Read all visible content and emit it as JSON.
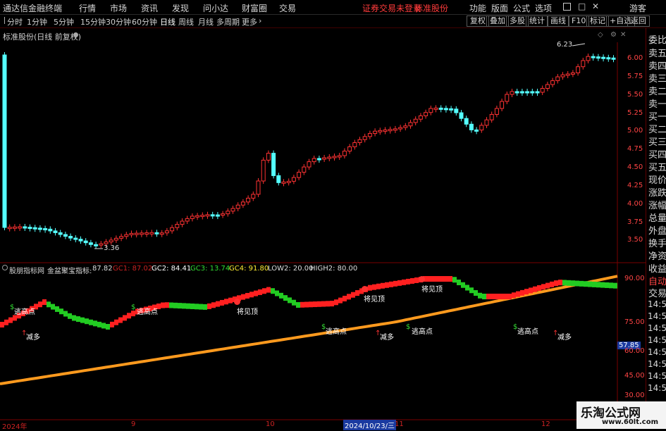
{
  "menu": {
    "app_title": "通达信金融终端",
    "items": [
      "行情",
      "市场",
      "资讯",
      "发现",
      "问小达",
      "财富圈",
      "交易"
    ],
    "notice": "证券交易未登录",
    "stock_name": "标准股份",
    "right_items": [
      "功能",
      "版面",
      "公式",
      "选项"
    ],
    "guest": "游客"
  },
  "period": {
    "items": [
      "分时",
      "1分钟",
      "5分钟",
      "15分钟",
      "30分钟",
      "60分钟",
      "日线",
      "周线",
      "月线",
      "多周期",
      "更多"
    ],
    "active": "日线",
    "buttons": [
      "复权",
      "叠加",
      "多股",
      "统计",
      "画线",
      "F10",
      "标记",
      "+自选",
      "返回"
    ]
  },
  "chart_header": {
    "title": "标准股份(日线 前复权)"
  },
  "price_axis": {
    "ticks": [
      "6.00",
      "5.75",
      "5.50",
      "5.25",
      "5.00",
      "4.75",
      "4.50",
      "4.25",
      "4.00",
      "3.75",
      "3.50"
    ]
  },
  "annotations": {
    "high": "6.23",
    "low": "3.36"
  },
  "indicator": {
    "name": "股朋指标网",
    "series_label": "金盆聚宝指标:",
    "series_value": "87.82",
    "gc1": "GC1: 87.02",
    "gc2": "GC2: 84.41",
    "gc3": "GC3: 13.74",
    "gc4": "GC4: 91.80",
    "low2": "LOW2: 20.00",
    "high2": "HIGH2: 80.00",
    "current": "57.85",
    "ticks": [
      "90.00",
      "75.00",
      "60.00",
      "45.00",
      "30.00"
    ]
  },
  "signals": {
    "sell_labels": [
      "逃高点",
      "逃高点",
      "逃高点",
      "逃高点",
      "逃高点"
    ],
    "top_labels": [
      "将见顶",
      "将见顶",
      "将见顶"
    ],
    "buy_labels": [
      "减多",
      "减多",
      "减多"
    ]
  },
  "date_axis": {
    "labels": [
      "2024年",
      "9",
      "10",
      "2024/10/23/三",
      "11",
      "12"
    ]
  },
  "right_panel": {
    "rows": [
      "委比",
      "卖五",
      "卖四",
      "卖三",
      "卖二",
      "卖一",
      "买一",
      "买二",
      "买三",
      "买四",
      "买五",
      "现价",
      "涨跌",
      "涨幅",
      "总量",
      "外盘",
      "换手",
      "净资",
      "收益"
    ],
    "bottom": [
      "自动",
      "交易"
    ],
    "ticks": [
      "14:5",
      "14:5",
      "14:5",
      "14:5",
      "14:5",
      "14:5",
      "14:5",
      "14:5"
    ]
  },
  "watermark": {
    "title": "乐淘公式网",
    "url": "www.60lt.com"
  },
  "colors": {
    "up": "#ff3232",
    "down": "#54ffff",
    "indicator_up": "#ff2020",
    "indicator_down": "#22cc22",
    "trend": "#ff9a1e"
  }
}
